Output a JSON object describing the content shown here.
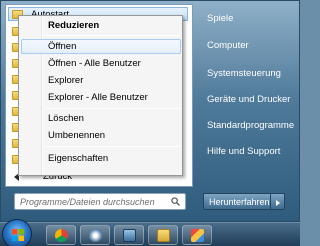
{
  "programs": {
    "autostart_label": "Autostart",
    "back_label": "Zurück"
  },
  "search": {
    "placeholder": "Programme/Dateien durchsuchen"
  },
  "right_pane": {
    "items": [
      "Spiele",
      "Computer",
      "Systemsteuerung",
      "Geräte und Drucker",
      "Standardprogramme",
      "Hilfe und Support"
    ]
  },
  "shutdown": {
    "label": "Herunterfahren"
  },
  "context_menu": {
    "items": [
      "Reduzieren",
      "Öffnen",
      "Öffnen - Alle Benutzer",
      "Explorer",
      "Explorer - Alle Benutzer",
      "Löschen",
      "Umbenennen",
      "Eigenschaften"
    ],
    "highlighted": "Öffnen"
  },
  "colors": {
    "highlight_border": "#a8cdf0",
    "folder": "#e2b640",
    "menu_gradient_dark": "#2f5b7c"
  },
  "taskbar": {
    "icons": [
      "start-orb",
      "chrome-icon",
      "media-icon",
      "monitor-icon",
      "folder-icon",
      "paint-icon"
    ]
  }
}
